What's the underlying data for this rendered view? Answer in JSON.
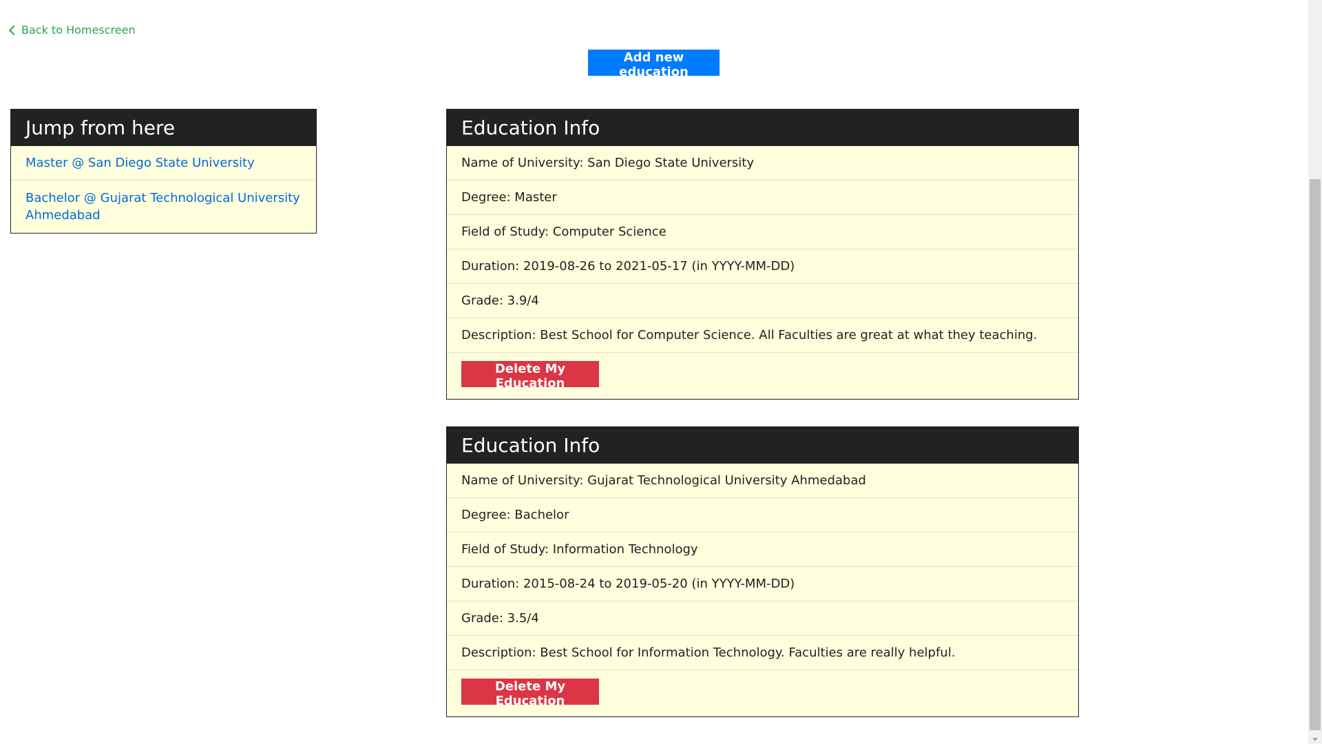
{
  "nav": {
    "back_label": "Back to Homescreen",
    "add_label": "Add new education"
  },
  "jump": {
    "title": "Jump from here",
    "items": [
      "Master @ San Diego State University",
      "Bachelor @ Gujarat Technological University Ahmedabad"
    ]
  },
  "educations": [
    {
      "title": "Education Info",
      "university": "Name of University: San Diego State University",
      "degree": "Degree: Master",
      "field": "Field of Study: Computer Science",
      "duration": "Duration: 2019-08-26 to 2021-05-17 (in YYYY-MM-DD)",
      "grade": "Grade: 3.9/4",
      "description": "Description: Best School for Computer Science. All Faculties are great at what they teaching.",
      "delete_label": "Delete My Education"
    },
    {
      "title": "Education Info",
      "university": "Name of University: Gujarat Technological University Ahmedabad",
      "degree": "Degree: Bachelor",
      "field": "Field of Study: Information Technology",
      "duration": "Duration: 2015-08-24 to 2019-05-20 (in YYYY-MM-DD)",
      "grade": "Grade: 3.5/4",
      "description": "Description: Best School for Information Technology. Faculties are really helpful.",
      "delete_label": "Delete My Education"
    }
  ],
  "colors": {
    "link_green": "#28a745",
    "primary_blue": "#007bff",
    "danger_red": "#dc3545",
    "panel_bg": "#fffedd",
    "header_bg": "#222222"
  }
}
